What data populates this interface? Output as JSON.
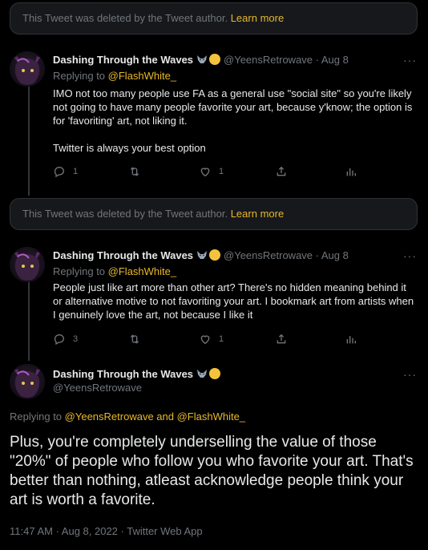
{
  "deleted_notice": {
    "text": "This Tweet was deleted by the Tweet author.",
    "link": "Learn more"
  },
  "tweets": [
    {
      "name": "Dashing Through the Waves",
      "handle_date": "@YeensRetrowave · Aug 8",
      "replying_label": "Replying to",
      "replying_to": "@FlashWhite_",
      "paragraphs": [
        "IMO not too many people use FA as a general use \"social site\" so you're likely not going to have many people favorite your art, because y'know; the option is for 'favoriting' art, not liking it.",
        "Twitter is always your best option"
      ],
      "replies": "1",
      "retweets": "",
      "likes": "1"
    },
    {
      "name": "Dashing Through the Waves",
      "handle_date": "@YeensRetrowave · Aug 8",
      "replying_label": "Replying to",
      "replying_to": "@FlashWhite_",
      "paragraphs": [
        "People just like art more than other art? There's no hidden meaning behind it or alternative motive to not favoriting your art. I bookmark art from artists when I genuinely love the art, not because I like it"
      ],
      "replies": "3",
      "retweets": "",
      "likes": "1"
    }
  ],
  "main_tweet": {
    "name": "Dashing Through the Waves",
    "handle": "@YeensRetrowave",
    "replying_label": "Replying to",
    "replying_to": "@YeensRetrowave and @FlashWhite_",
    "text": "Plus, you're completely underselling the value of those \"20%\" of people who follow you who favorite your art. That's better than nothing, atleast acknowledge people think your art is worth a favorite.",
    "timestamp": "11:47 AM · Aug 8, 2022 · Twitter Web App"
  },
  "more_label": "···",
  "colors": {
    "background": "#000000",
    "accent": "#e7b82c",
    "muted": "#71767b",
    "text": "#e7e9ea",
    "card": "#16181c"
  },
  "icons": [
    "reply-icon",
    "retweet-icon",
    "like-icon",
    "share-icon",
    "analytics-icon",
    "more-icon",
    "wolf-emoji-icon",
    "gold-badge-icon"
  ]
}
